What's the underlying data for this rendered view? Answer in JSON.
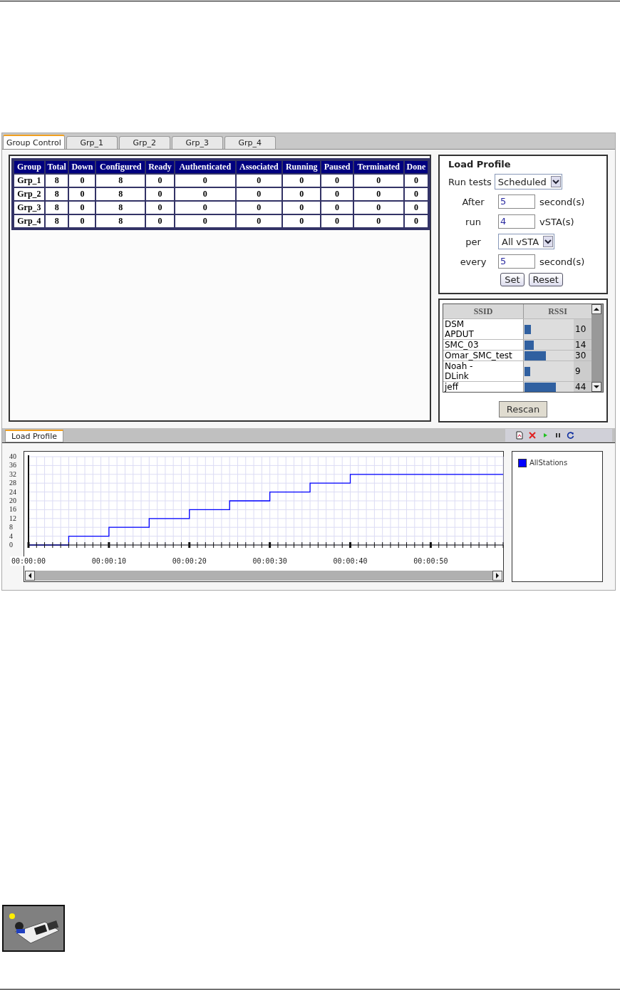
{
  "tabs": [
    {
      "label": "Group Control",
      "selected": true
    },
    {
      "label": "Grp_1",
      "selected": false
    },
    {
      "label": "Grp_2",
      "selected": false
    },
    {
      "label": "Grp_3",
      "selected": false
    },
    {
      "label": "Grp_4",
      "selected": false
    }
  ],
  "group_table": {
    "columns": [
      "Group",
      "Total",
      "Down",
      "Configured",
      "Ready",
      "Authenticated",
      "Associated",
      "Running",
      "Paused",
      "Terminated",
      "Done"
    ],
    "rows": [
      [
        "Grp_1",
        "8",
        "0",
        "8",
        "0",
        "0",
        "0",
        "0",
        "0",
        "0",
        "0"
      ],
      [
        "Grp_2",
        "8",
        "0",
        "8",
        "0",
        "0",
        "0",
        "0",
        "0",
        "0",
        "0"
      ],
      [
        "Grp_3",
        "8",
        "0",
        "8",
        "0",
        "0",
        "0",
        "0",
        "0",
        "0",
        "0"
      ],
      [
        "Grp_4",
        "8",
        "0",
        "8",
        "0",
        "0",
        "0",
        "0",
        "0",
        "0",
        "0"
      ]
    ]
  },
  "load_profile": {
    "title": "Load Profile",
    "fields": [
      {
        "kind": "select",
        "label": "Run tests",
        "value": "Scheduled"
      },
      {
        "kind": "input",
        "label": "After",
        "value": "5",
        "unit": "second(s)"
      },
      {
        "kind": "input",
        "label": "run",
        "value": "4",
        "unit": "vSTA(s)"
      },
      {
        "kind": "select",
        "label": "per",
        "value": "All vSTA"
      },
      {
        "kind": "input",
        "label": "every",
        "value": "5",
        "unit": "second(s)"
      }
    ],
    "buttons": [
      "Set",
      "Reset"
    ]
  },
  "ssid_list": {
    "columns": [
      "SSID",
      "RSSI"
    ],
    "rows": [
      {
        "ssid": "DSM\nAPDUT",
        "rssi": "10",
        "level": 0.13
      },
      {
        "ssid": "SMC_03",
        "rssi": "14",
        "level": 0.19
      },
      {
        "ssid": "Omar_SMC_test",
        "rssi": "30",
        "level": 0.43
      },
      {
        "ssid": "Noah -\nDLink",
        "rssi": "9",
        "level": 0.12
      },
      {
        "ssid": "jeff",
        "rssi": "44",
        "level": 0.63
      }
    ],
    "rescan": "Rescan"
  },
  "bottom_tabs": [
    {
      "label": "Load Profile",
      "selected": true
    }
  ],
  "chart": {
    "chart_data": {
      "type": "line",
      "x": [
        0,
        5,
        5,
        10,
        10,
        15,
        15,
        20,
        20,
        25,
        25,
        30,
        30,
        35,
        35,
        40,
        40,
        59
      ],
      "series": [
        {
          "name": "AllStations",
          "color": "#0000ff",
          "values": [
            0,
            0,
            4,
            4,
            8,
            8,
            12,
            12,
            16,
            16,
            20,
            20,
            24,
            24,
            28,
            28,
            32,
            32
          ]
        }
      ],
      "xlim": [
        0,
        59
      ],
      "ylim": [
        0,
        40
      ],
      "xticks": [
        {
          "value": 0,
          "label": "00:00:00"
        },
        {
          "value": 10,
          "label": "00:00:10"
        },
        {
          "value": 20,
          "label": "00:00:20"
        },
        {
          "value": 30,
          "label": "00:00:30"
        },
        {
          "value": 40,
          "label": "00:00:40"
        },
        {
          "value": 50,
          "label": "00:00:50"
        }
      ],
      "yticks": [
        0,
        4,
        8,
        12,
        16,
        20,
        24,
        28,
        32,
        36,
        40
      ],
      "grid": true
    }
  }
}
